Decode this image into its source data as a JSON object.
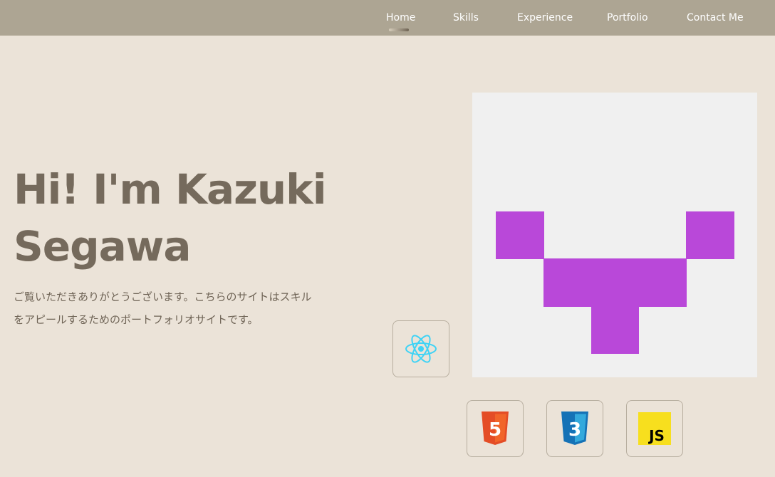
{
  "nav": {
    "items": [
      {
        "label": "Home",
        "active": true
      },
      {
        "label": "Skills",
        "active": false
      },
      {
        "label": "Experience",
        "active": false
      },
      {
        "label": "Portfolio",
        "active": false
      },
      {
        "label": "Contact Me",
        "active": false
      }
    ]
  },
  "hero": {
    "title": "Hi! I'm Kazuki Segawa",
    "description": "ご覧いただきありがとうございます。こちらのサイトはスキルをアピールするためのポートフォリオサイトです。"
  },
  "avatar": {
    "icon": "pixel-identicon",
    "color": "#b948d9",
    "background": "#f0f0f0"
  },
  "skills": [
    {
      "icon": "react-icon",
      "label": "React"
    },
    {
      "icon": "html5-icon",
      "label": "5"
    },
    {
      "icon": "css3-icon",
      "label": "3"
    },
    {
      "icon": "javascript-icon",
      "label": "JS"
    }
  ],
  "colors": {
    "nav_bg": "#ada593",
    "page_bg": "#ebe3d8",
    "heading": "#756a5c",
    "react": "#61dafb",
    "html5": "#e44d26",
    "css3": "#1572b6",
    "js": "#f7df1e"
  }
}
